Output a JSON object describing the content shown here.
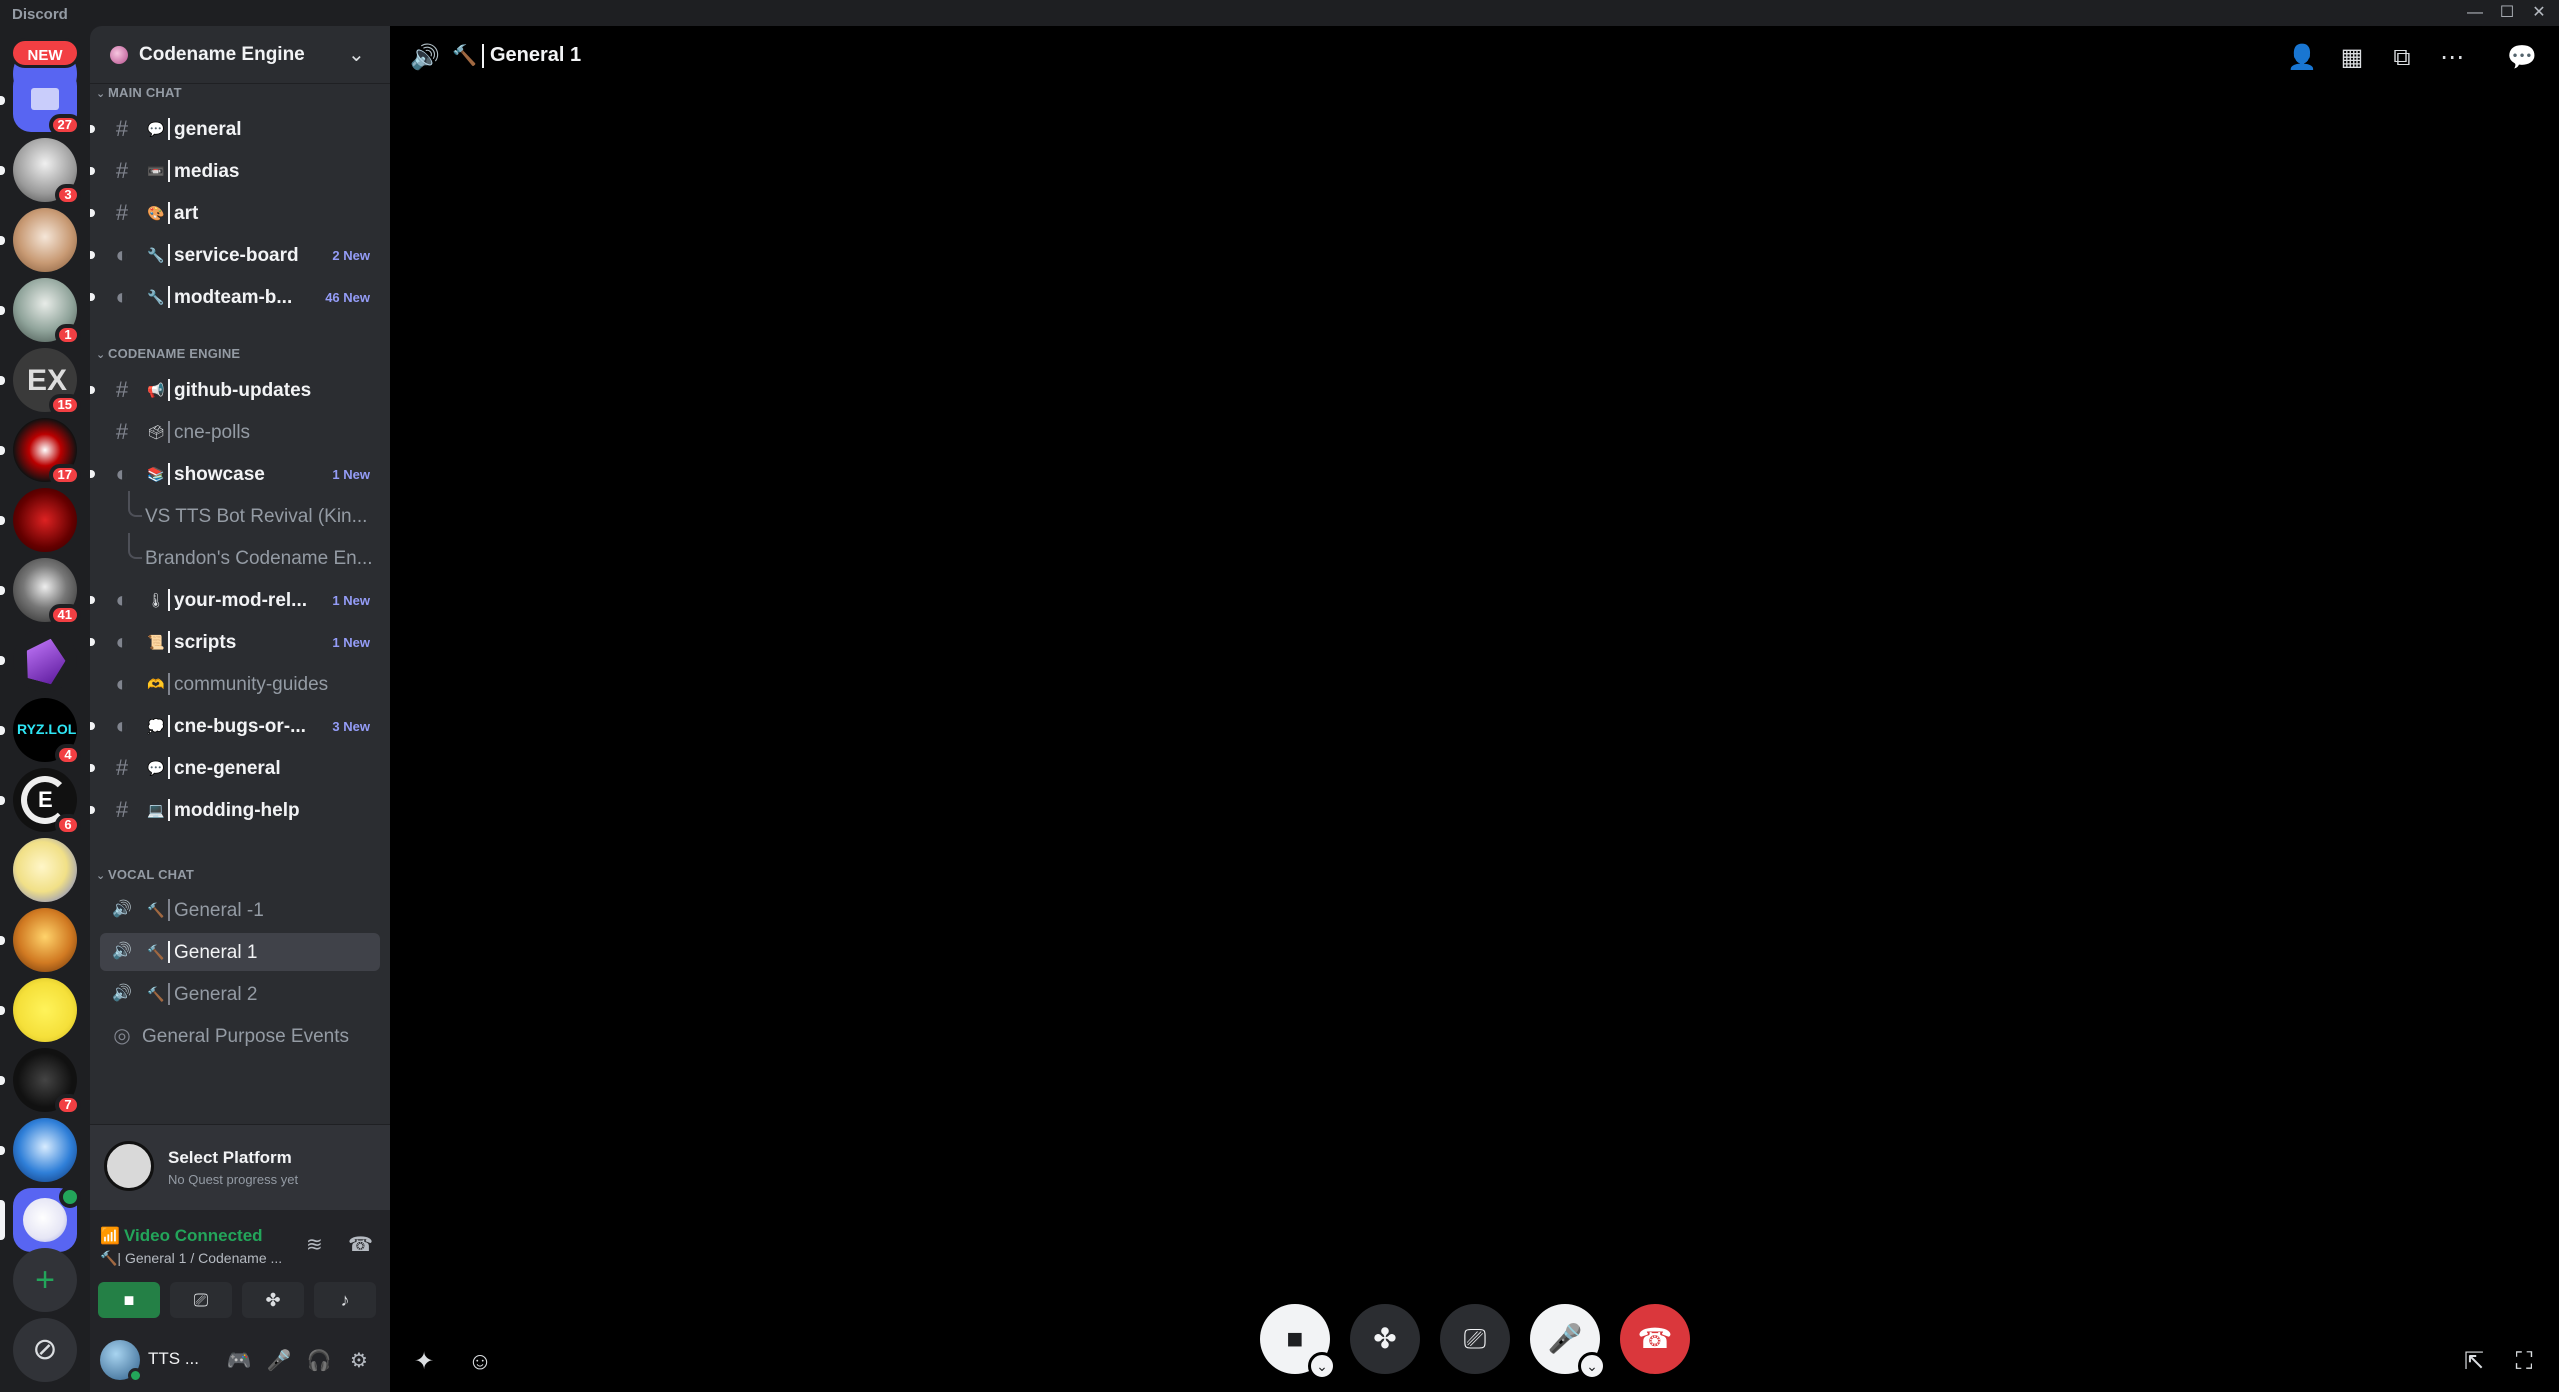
{
  "window": {
    "app_name": "Discord",
    "minimize_glyph": "—",
    "maximize_glyph": "☐",
    "close_glyph": "✕"
  },
  "rail": {
    "new_badge": "NEW",
    "servers": [
      {
        "badge": "27"
      },
      {
        "badge": "3"
      },
      {
        "badge": ""
      },
      {
        "badge": "1"
      },
      {
        "badge": "15"
      },
      {
        "badge": "17"
      },
      {
        "badge": ""
      },
      {
        "badge": "41"
      },
      {
        "badge": ""
      },
      {
        "badge": "4"
      },
      {
        "badge": "6"
      },
      {
        "badge": ""
      },
      {
        "badge": ""
      },
      {
        "badge": ""
      },
      {
        "badge": "7"
      },
      {
        "badge": ""
      },
      {
        "badge": ""
      }
    ],
    "add_glyph": "+",
    "discover_glyph": "⊘"
  },
  "guild": {
    "name": "Codename Engine",
    "chevron": "⌄"
  },
  "categories": {
    "main_chat": "MAIN CHAT",
    "codename_engine": "CODENAME ENGINE",
    "vocal_chat": "VOCAL CHAT"
  },
  "channels": {
    "general": {
      "icon": "#",
      "emoji": "💬",
      "name": "general",
      "new": ""
    },
    "medias": {
      "icon": "#",
      "emoji": "📼",
      "name": "medias",
      "new": ""
    },
    "art": {
      "icon": "#",
      "emoji": "🎨",
      "name": "art",
      "new": ""
    },
    "service_board": {
      "icon": "◐",
      "emoji": "🔧",
      "name": "service-board",
      "new": "2 New"
    },
    "modteam": {
      "icon": "◐",
      "emoji": "🔧",
      "name": "modteam-b...",
      "new": "46 New"
    },
    "github_updates": {
      "icon": "#",
      "emoji": "📢",
      "name": "github-updates",
      "new": ""
    },
    "cne_polls": {
      "icon": "#",
      "emoji": "🗳",
      "name": "cne-polls",
      "new": ""
    },
    "showcase": {
      "icon": "◐",
      "emoji": "📚",
      "name": "showcase",
      "new": "1 New"
    },
    "thread1": {
      "name": "VS TTS Bot Revival (Kin..."
    },
    "thread2": {
      "name": "Brandon's Codename En..."
    },
    "your_mod": {
      "icon": "◐",
      "emoji": "🌡",
      "name": "your-mod-rel...",
      "new": "1 New"
    },
    "scripts": {
      "icon": "◐",
      "emoji": "📜",
      "name": "scripts",
      "new": "1 New"
    },
    "community_guides": {
      "icon": "◐",
      "emoji": "🫶",
      "name": "community-guides",
      "new": ""
    },
    "cne_bugs": {
      "icon": "◐",
      "emoji": "💭",
      "name": "cne-bugs-or-...",
      "new": "3 New"
    },
    "cne_general": {
      "icon": "#",
      "emoji": "💬",
      "name": "cne-general",
      "new": ""
    },
    "modding_help": {
      "icon": "#",
      "emoji": "💻",
      "name": "modding-help",
      "new": ""
    },
    "general_m1": {
      "icon": "🔊",
      "emoji": "🔨",
      "name": "General -1",
      "new": ""
    },
    "general_1": {
      "icon": "🔊",
      "emoji": "🔨",
      "name": "General 1",
      "new": ""
    },
    "general_2": {
      "icon": "🔊",
      "emoji": "🔨",
      "name": "General 2",
      "new": ""
    },
    "events": {
      "icon": "◎",
      "name": "General Purpose Events"
    }
  },
  "quest": {
    "title": "Select Platform",
    "subtitle": "No Quest progress yet"
  },
  "voice": {
    "status": "Video Connected",
    "channel": "🔨| General 1 / Codename ...",
    "signal_glyph": "📶"
  },
  "user": {
    "name": "TTS ..."
  },
  "stage": {
    "title": "General 1"
  }
}
